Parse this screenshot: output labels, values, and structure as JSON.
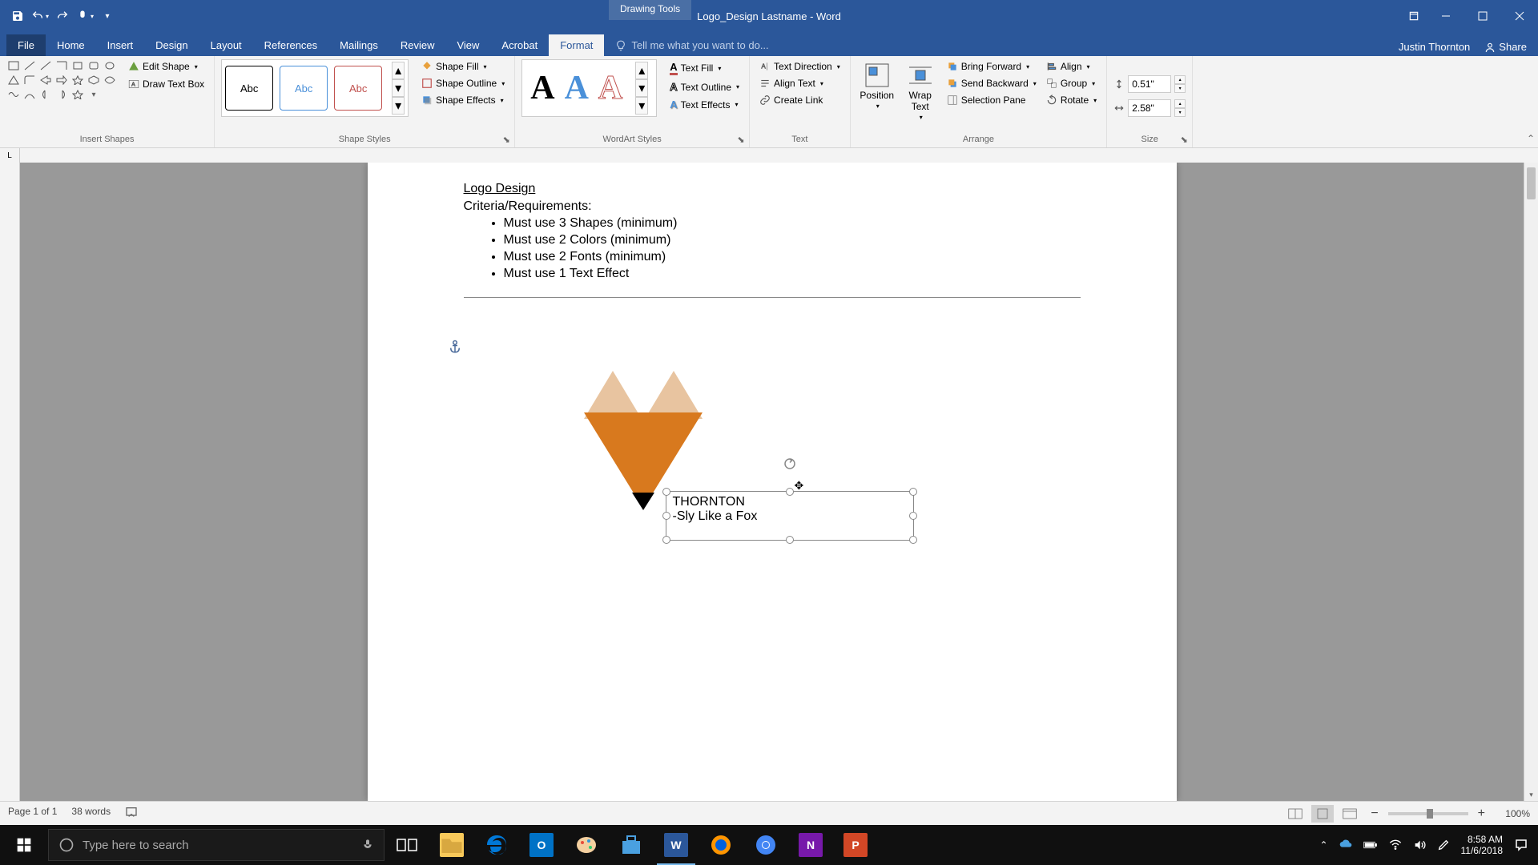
{
  "titlebar": {
    "title": "Logo_Design Lastname - Word",
    "contextual_tab": "Drawing Tools"
  },
  "tabs": {
    "file": "File",
    "home": "Home",
    "insert": "Insert",
    "design": "Design",
    "layout": "Layout",
    "references": "References",
    "mailings": "Mailings",
    "review": "Review",
    "view": "View",
    "acrobat": "Acrobat",
    "format": "Format",
    "tell_me": "Tell me what you want to do...",
    "user": "Justin Thornton",
    "share": "Share"
  },
  "ribbon": {
    "insert_shapes": {
      "edit_shape": "Edit Shape",
      "draw_text_box": "Draw Text Box",
      "label": "Insert Shapes"
    },
    "shape_styles": {
      "preset_label": "Abc",
      "shape_fill": "Shape Fill",
      "shape_outline": "Shape Outline",
      "shape_effects": "Shape Effects",
      "label": "Shape Styles"
    },
    "wordart": {
      "text_fill": "Text Fill",
      "text_outline": "Text Outline",
      "text_effects": "Text Effects",
      "label": "WordArt Styles"
    },
    "text": {
      "text_direction": "Text Direction",
      "align_text": "Align Text",
      "create_link": "Create Link",
      "label": "Text"
    },
    "arrange": {
      "position": "Position",
      "wrap_text": "Wrap Text",
      "bring_forward": "Bring Forward",
      "send_backward": "Send Backward",
      "selection_pane": "Selection Pane",
      "align": "Align",
      "group": "Group",
      "rotate": "Rotate",
      "label": "Arrange"
    },
    "size": {
      "height": "0.51\"",
      "width": "2.58\"",
      "label": "Size"
    }
  },
  "ruler": {
    "corner": "L"
  },
  "document": {
    "heading": "Logo Design",
    "criteria_label": "Criteria/Requirements:",
    "bullets": [
      "Must use 3 Shapes (minimum)",
      "Must use 2 Colors (minimum)",
      "Must use 2 Fonts (minimum)",
      "Must use 1 Text Effect"
    ],
    "textbox": {
      "line1": "THORNTON",
      "line2": "-Sly Like a Fox"
    }
  },
  "statusbar": {
    "page": "Page 1 of 1",
    "words": "38 words",
    "zoom": "100%"
  },
  "taskbar": {
    "search_placeholder": "Type here to search",
    "time": "8:58 AM",
    "date": "11/6/2018"
  }
}
